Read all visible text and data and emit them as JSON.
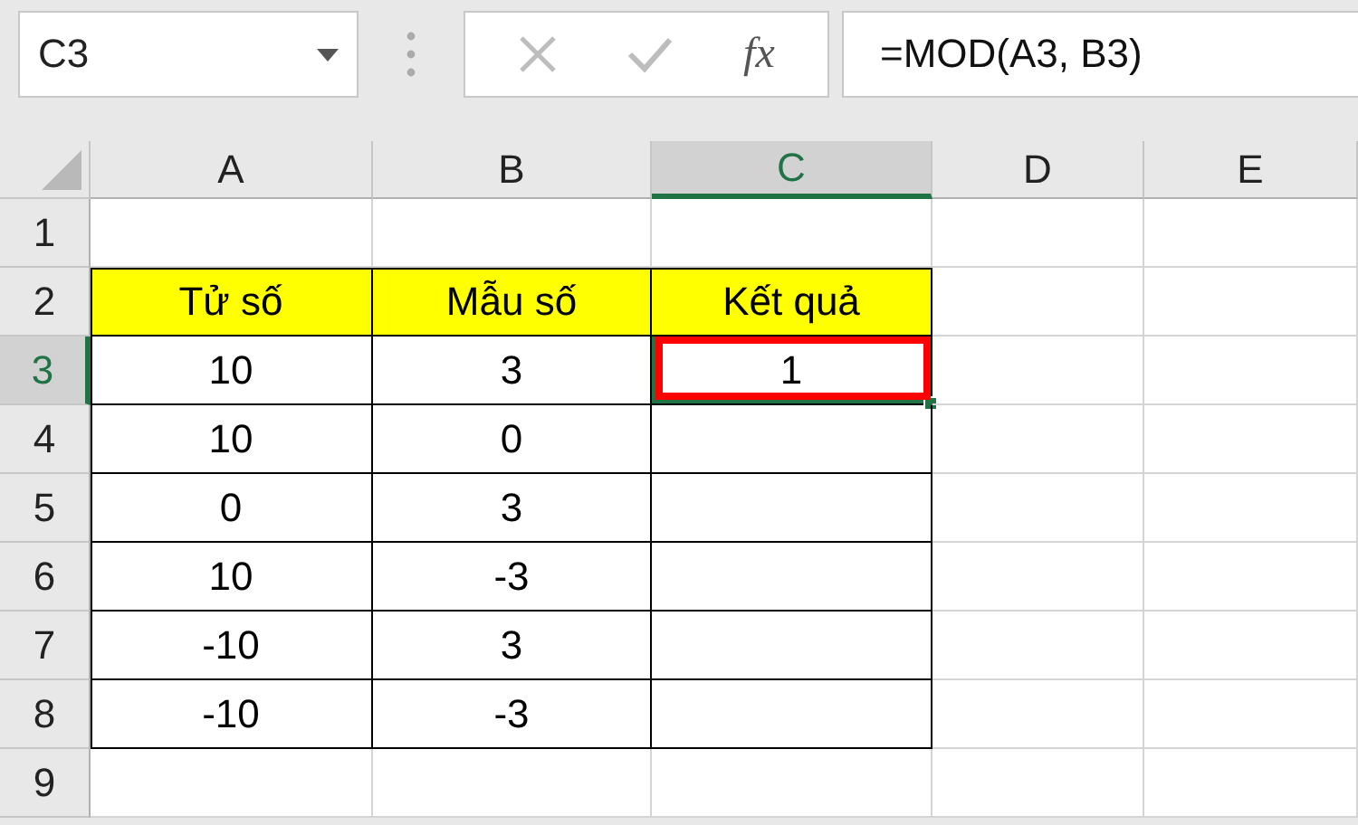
{
  "name_box": {
    "value": "C3"
  },
  "formula_bar": {
    "function_label": "fx",
    "value": "=MOD(A3, B3)"
  },
  "sheet": {
    "columns": [
      {
        "label": "A",
        "selected": false
      },
      {
        "label": "B",
        "selected": false
      },
      {
        "label": "C",
        "selected": true
      },
      {
        "label": "D",
        "selected": false
      },
      {
        "label": "E",
        "selected": false
      }
    ],
    "rows": [
      {
        "label": "1",
        "selected": false
      },
      {
        "label": "2",
        "selected": false
      },
      {
        "label": "3",
        "selected": true
      },
      {
        "label": "4",
        "selected": false
      },
      {
        "label": "5",
        "selected": false
      },
      {
        "label": "6",
        "selected": false
      },
      {
        "label": "7",
        "selected": false
      },
      {
        "label": "8",
        "selected": false
      },
      {
        "label": "9",
        "selected": false
      }
    ],
    "table": {
      "head": [
        "Tử số",
        "Mẫu số",
        "Kết quả"
      ],
      "body": [
        [
          {
            "value": "10",
            "selected": false,
            "highlighted": false
          },
          {
            "value": "3",
            "selected": false,
            "highlighted": false
          },
          {
            "value": "1",
            "selected": true,
            "highlighted": true
          }
        ],
        [
          {
            "value": "10",
            "selected": false,
            "highlighted": false
          },
          {
            "value": "0",
            "selected": false,
            "highlighted": false
          },
          {
            "selected": false,
            "highlighted": false
          }
        ],
        [
          {
            "value": "0",
            "selected": false,
            "highlighted": false
          },
          {
            "value": "3",
            "selected": false,
            "highlighted": false
          },
          {
            "selected": false,
            "highlighted": false
          }
        ],
        [
          {
            "value": "10",
            "selected": false,
            "highlighted": false
          },
          {
            "value": "-3",
            "selected": false,
            "highlighted": false
          },
          {
            "selected": false,
            "highlighted": false
          }
        ],
        [
          {
            "value": "-10",
            "selected": false,
            "highlighted": false
          },
          {
            "value": "3",
            "selected": false,
            "highlighted": false
          },
          {
            "selected": false,
            "highlighted": false
          }
        ],
        [
          {
            "value": "-10",
            "selected": false,
            "highlighted": false
          },
          {
            "value": "-3",
            "selected": false,
            "highlighted": false
          },
          {
            "selected": false,
            "highlighted": false
          }
        ]
      ]
    }
  }
}
